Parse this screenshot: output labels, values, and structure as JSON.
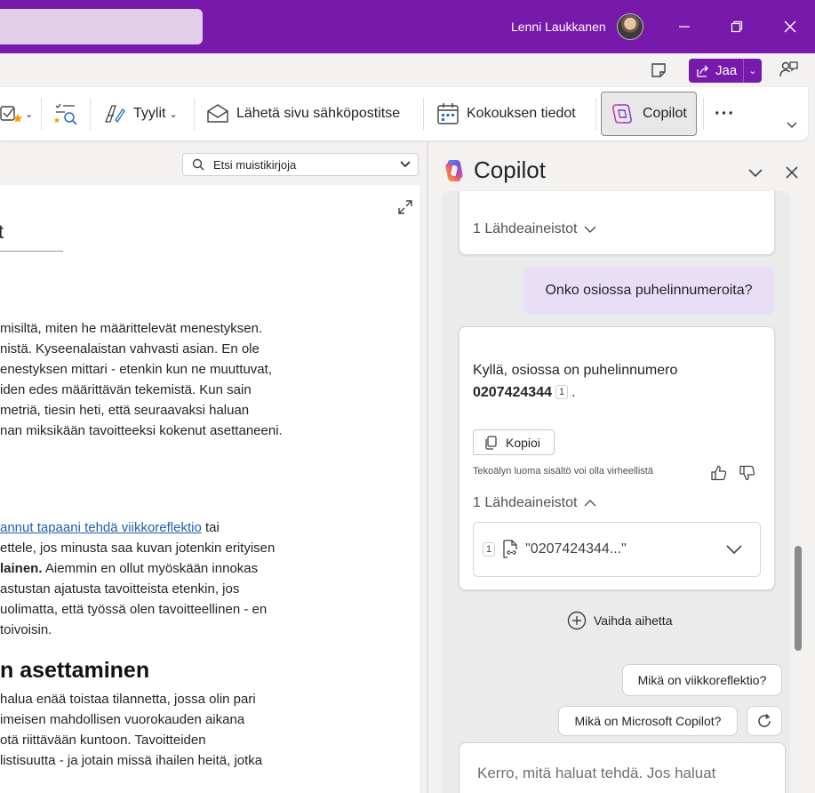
{
  "titlebar": {
    "user_name": "Lenni Laukkanen",
    "minimize": "—",
    "restore": "❐",
    "close": "✕"
  },
  "toolbar2": {
    "share_label": "Jaa"
  },
  "ribbon": {
    "styles_label": "Tyylit",
    "email_page_label": "Lähetä sivu sähköpostitse",
    "meeting_details_label": "Kokouksen tiedot",
    "copilot_label": "Copilot",
    "more_label": "···"
  },
  "note": {
    "search_placeholder": "Etsi muistikirjoja",
    "title_fragment": "t",
    "paragraph1": [
      "misiltä, miten he määrittelevät menestyksen.",
      "nistä. Kyseenalaistan vahvasti asian. En ole",
      "enestyksen mittari - etenkin kun ne muuttuvat,",
      "iden edes määrittävän tekemistä. Kun sain",
      "metriä, tiesin heti, että seuraavaksi haluan",
      "nan miksikään tavoitteeksi kokenut asettaneeni."
    ],
    "paragraph2_link": "annut tapaani tehdä viikkoreflektio",
    "paragraph2_link_tail": " tai",
    "paragraph2_line2": "ettele, jos minusta saa kuvan jotenkin erityisen",
    "paragraph2_line3_bold": "lainen.",
    "paragraph2_line3_rest": " Aiemmin en ollut myöskään innokas",
    "paragraph2_line4": "astustan ajatusta tavoitteista etenkin, jos",
    "paragraph2_line5": "uolimatta, että työssä olen tavoitteellinen - en",
    "paragraph2_line6": "toivoisin.",
    "heading": "n asettaminen",
    "paragraph3": [
      "halua enää toistaa tilannetta, jossa olin pari",
      "imeisen mahdollisen vuorokauden aikana",
      "otä riittävään kuntoon. Tavoitteiden",
      "listisuutta - ja jotain missä ihailen heitä, jotka"
    ]
  },
  "copilot": {
    "title": "Copilot",
    "prev_sources_label": "1 Lähdeaineistot",
    "user_question": "Onko osiossa puhelinnumeroita?",
    "answer_line1": "Kyllä, osiossa on puhelinnumero",
    "answer_number": "0207424344",
    "answer_cite": "1",
    "answer_end": ".",
    "copy_label": "Kopioi",
    "disclaimer": "Tekoälyn luoma sisältö voi olla virheellistä",
    "sources_label": "1 Lähdeaineistot",
    "source_index": "1",
    "source_text": "\"0207424344...\"",
    "new_topic_label": "Vaihda aihetta",
    "suggestion1": "Mikä on viikkoreflektio?",
    "suggestion2": "Mikä on Microsoft Copilot?",
    "input_placeholder": "Kerro, mitä haluat tehdä. Jos haluat"
  }
}
